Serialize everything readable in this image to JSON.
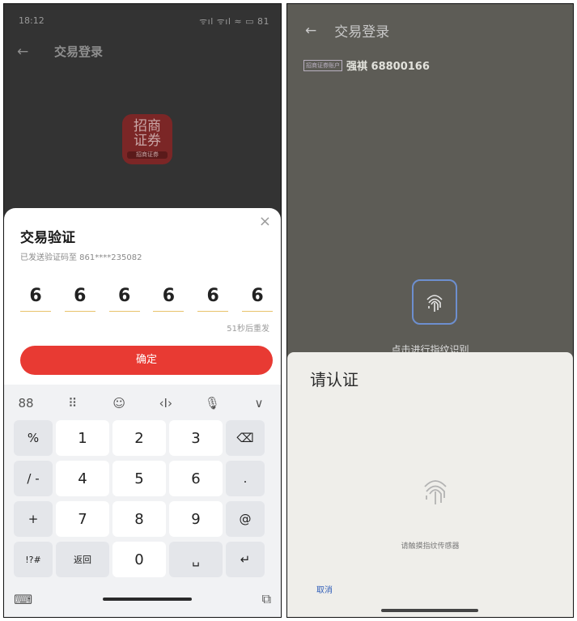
{
  "left": {
    "status": {
      "time": "18:12",
      "right": "ᯤıl ᯤıl ≈ ▭ 81"
    },
    "nav": {
      "back": "←",
      "title": "交易登录"
    },
    "logo": {
      "line1": "招商",
      "line2": "证券",
      "sub": "招商证券"
    },
    "sheet": {
      "close": "×",
      "title": "交易验证",
      "subtitle": "已发送验证码至 861****235082",
      "code": [
        "6",
        "6",
        "6",
        "6",
        "6",
        "6"
      ],
      "resend": "51秒后重发",
      "confirm": "确定"
    },
    "keyboard": {
      "toolbar": [
        "88",
        "⠿",
        "☺",
        "‹I›",
        "🎙",
        "∨"
      ],
      "rows": [
        [
          "%",
          "1",
          "2",
          "3",
          "⌫"
        ],
        [
          "/ -",
          "4",
          "5",
          "6",
          "."
        ],
        [
          "+",
          "7",
          "8",
          "9",
          "@"
        ],
        [
          "!?#",
          "返回",
          "0",
          "␣",
          "↵"
        ]
      ],
      "bottom_left": "⌨",
      "bottom_right": "⧉"
    }
  },
  "right": {
    "nav": {
      "back": "←",
      "title": "交易登录"
    },
    "account": {
      "badge": "招商证券账户",
      "text": "强褀 68800166"
    },
    "fingerprint_hint": "点击进行指纹识别",
    "auth": {
      "title": "请认证",
      "hint": "请触摸指纹传感器",
      "cancel": "取消"
    }
  }
}
